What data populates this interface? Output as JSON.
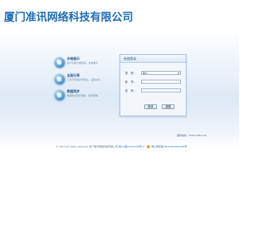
{
  "header": {
    "company_name": "厦门准讯网络科技有限公司"
  },
  "features": [
    {
      "title": "多维展示",
      "desc": "用户管理方面维度，多维展示",
      "icon": "globe-icon"
    },
    {
      "title": "全面分享",
      "desc": "人员及管理资讯信息，设置共享",
      "icon": "share-icon"
    },
    {
      "title": "数据同步",
      "desc": "数据信息同步更新，随时更新",
      "icon": "sync-icon"
    }
  ],
  "login": {
    "panel_title": "系统登录",
    "type_label": "类　型：",
    "type_value": "客户",
    "account_label": "帐　号：",
    "account_value": "",
    "password_label": "密　码：",
    "password_value": "",
    "login_button": "登录",
    "reset_button": "重置"
  },
  "hotline": "服务热线：0592-5581118",
  "footer": {
    "copyright": "© 2015 All rights reserved. 厦门准讯网络科技有限公司",
    "icp": "闽ICP备12010136号-2",
    "police": "闽公网安备35020302001056号"
  },
  "colors": {
    "title": "#1e6bb8",
    "band": "#dde9f6",
    "panel_border": "#a9c4e2"
  }
}
